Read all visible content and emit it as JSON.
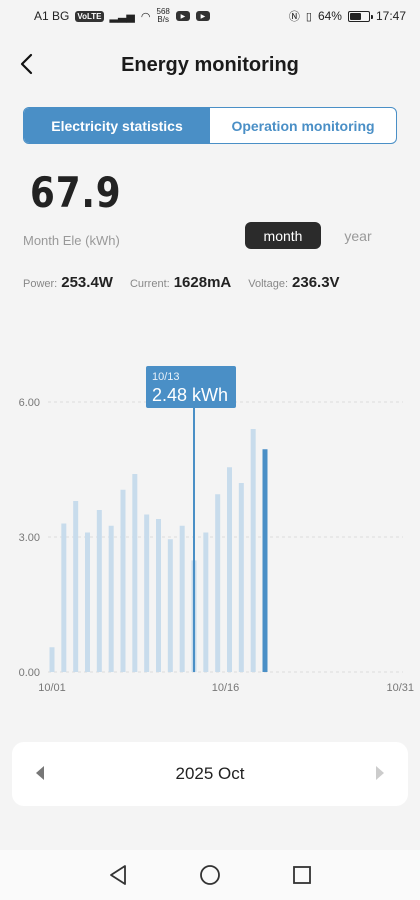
{
  "status_bar": {
    "carrier": "A1 BG",
    "volte": "VoLTE",
    "net_speed_value": "568",
    "net_speed_unit": "B/s",
    "battery": "64%",
    "time": "17:47"
  },
  "header": {
    "title": "Energy monitoring"
  },
  "tabs": [
    {
      "label": "Electricity statistics",
      "active": true
    },
    {
      "label": "Operation monitoring",
      "active": false
    }
  ],
  "summary": {
    "value": "67.9",
    "unit_label": "Month Ele (kWh)",
    "period_month": "month",
    "period_year": "year"
  },
  "readings": {
    "power_label": "Power:",
    "power_value": "253.4W",
    "current_label": "Current:",
    "current_value": "1628mA",
    "voltage_label": "Voltage:",
    "voltage_value": "236.3V"
  },
  "chart_data": {
    "type": "bar",
    "categories": [
      "10/01",
      "10/02",
      "10/03",
      "10/04",
      "10/05",
      "10/06",
      "10/07",
      "10/08",
      "10/09",
      "10/10",
      "10/11",
      "10/12",
      "10/13",
      "10/14",
      "10/15",
      "10/16",
      "10/17",
      "10/18",
      "10/19"
    ],
    "values": [
      0.55,
      3.3,
      3.8,
      3.1,
      3.6,
      3.25,
      4.05,
      4.4,
      3.5,
      3.4,
      2.95,
      3.25,
      2.48,
      3.1,
      3.95,
      4.55,
      4.2,
      5.4,
      4.95
    ],
    "x_tick_labels": [
      "10/01",
      "10/16",
      "10/31"
    ],
    "y_tick_labels": [
      "0.00",
      "3.00",
      "6.00"
    ],
    "ylim": [
      0,
      6.5
    ],
    "xlim_days": [
      1,
      31
    ],
    "grid": true,
    "tooltip": {
      "date": "10/13",
      "value": "2.48 kWh"
    },
    "colors": {
      "bar": "#c8dcec",
      "highlight": "#4a8fc6",
      "today": "#4a8fc6"
    }
  },
  "month_selector": {
    "label": "2025 Oct"
  },
  "colors": {
    "accent": "#4a8fc6"
  }
}
